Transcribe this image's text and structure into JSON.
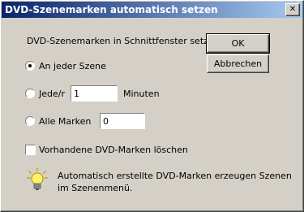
{
  "dialog": {
    "title": "DVD-Szenemarken automatisch setzen",
    "close_glyph": "✕",
    "section_label": "DVD-Szenemarken in Schnittfenster setzen:",
    "ok_label": "OK",
    "cancel_label": "Abbrechen",
    "options": [
      {
        "label": "An jeder Szene",
        "selected": true
      },
      {
        "label": "Jede/r",
        "value": "1",
        "unit": "Minuten",
        "selected": false
      },
      {
        "label": "Alle Marken",
        "value": "0",
        "selected": false
      }
    ],
    "delete_checkbox": {
      "label": "Vorhandene DVD-Marken löschen",
      "checked": false
    },
    "hint_text": "Automatisch erstellte DVD-Marken erzeugen Szenen im Szenenmenü.",
    "hint_icon": "lightbulb-icon"
  }
}
